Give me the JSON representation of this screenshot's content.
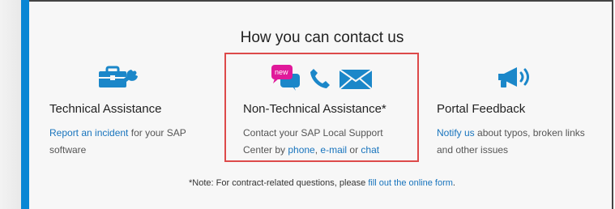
{
  "heading": "How you can contact us",
  "columns": [
    {
      "icon": "toolbox-wrench-icon",
      "title": "Technical Assistance",
      "desc_link": "Report an incident",
      "desc_text": " for your SAP software"
    },
    {
      "icon": "chat-phone-mail-icons",
      "icon_badge": "new",
      "title": "Non-Technical Assistance*",
      "desc_prefix": "Contact your SAP Local Support Center by ",
      "link_phone": "phone",
      "sep1": ", ",
      "link_email": "e-mail",
      "sep2": " or ",
      "link_chat": "chat"
    },
    {
      "icon": "megaphone-icon",
      "title": "Portal Feedback",
      "desc_link": "Notify us",
      "desc_text": " about typos, broken links and other issues"
    }
  ],
  "note": {
    "prefix": "*Note: For contract-related questions, please ",
    "link": "fill out the online form",
    "suffix": "."
  },
  "colors": {
    "accent": "#0a86d4",
    "link": "#1874bd",
    "highlight_border": "#dd4a4a",
    "badge": "#e0199a"
  }
}
